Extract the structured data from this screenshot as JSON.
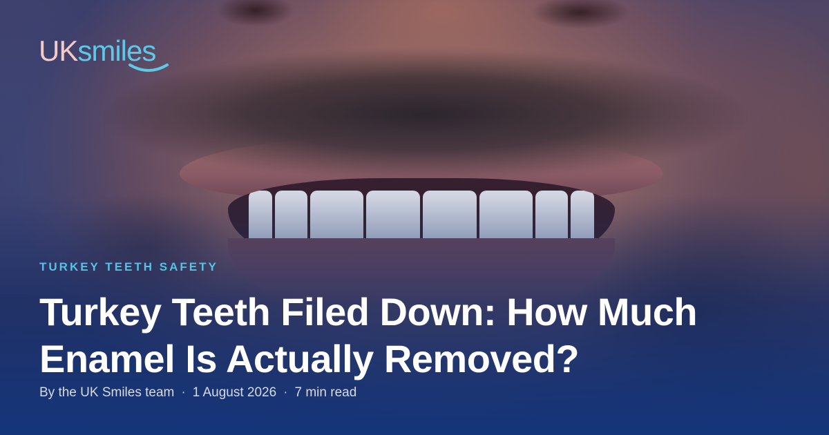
{
  "brand": {
    "logo_part1": "UK",
    "logo_part2": "smiles",
    "colors": {
      "pink": "#f4c9c7",
      "cyan": "#5ec8e6"
    }
  },
  "article": {
    "category": "TURKEY TEETH SAFETY",
    "title": "Turkey Teeth Filed Down: How Much Enamel Is Actually Removed?",
    "author": "By the UK Smiles team",
    "date": "1 August 2026",
    "read_time": "7 min read",
    "separator": "·"
  },
  "colors": {
    "accent": "#57c3e2",
    "background": "#14357a",
    "title": "#ffffff"
  }
}
